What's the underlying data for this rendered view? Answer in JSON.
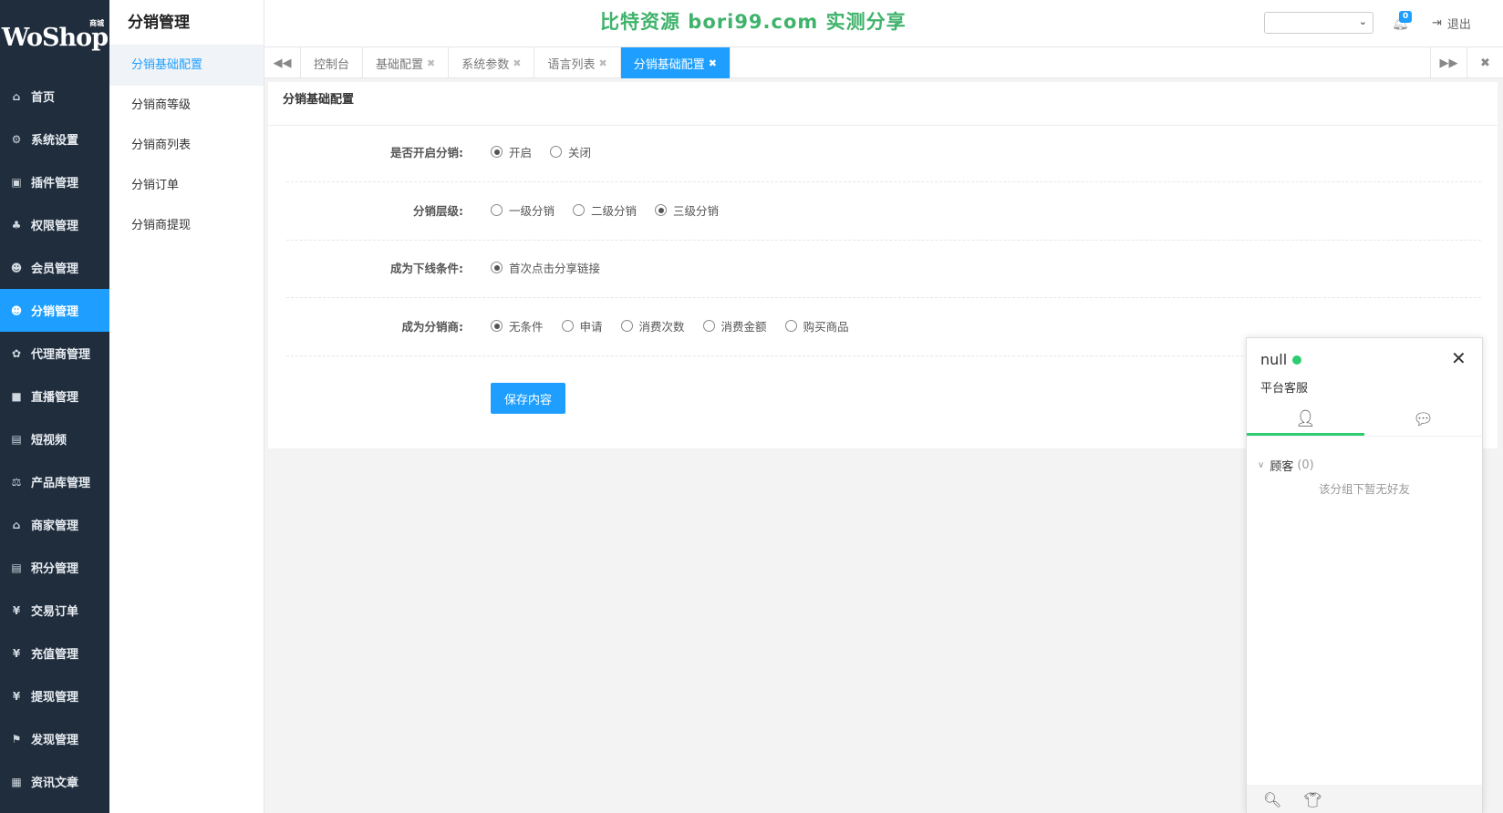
{
  "brand": {
    "name": "WoShop",
    "sup": "商城"
  },
  "nav": [
    {
      "icon": "home-icon",
      "glyph": "⌂",
      "label": "首页"
    },
    {
      "icon": "gear-icon",
      "glyph": "⚙",
      "label": "系统设置"
    },
    {
      "icon": "plugin-icon",
      "glyph": "▣",
      "label": "插件管理"
    },
    {
      "icon": "sitemap-icon",
      "glyph": "♣",
      "label": "权限管理"
    },
    {
      "icon": "users-icon",
      "glyph": "☻",
      "label": "会员管理"
    },
    {
      "icon": "users-icon",
      "glyph": "☻",
      "label": "分销管理",
      "active": true
    },
    {
      "icon": "agent-icon",
      "glyph": "✿",
      "label": "代理商管理"
    },
    {
      "icon": "video-camera-icon",
      "glyph": "■",
      "label": "直播管理"
    },
    {
      "icon": "document-icon",
      "glyph": "▤",
      "label": "短视频"
    },
    {
      "icon": "scale-icon",
      "glyph": "⚖",
      "label": "产品库管理"
    },
    {
      "icon": "bank-icon",
      "glyph": "⌂",
      "label": "商家管理"
    },
    {
      "icon": "points-icon",
      "glyph": "▤",
      "label": "积分管理"
    },
    {
      "icon": "yen-icon",
      "glyph": "¥",
      "label": "交易订单"
    },
    {
      "icon": "yen-icon",
      "glyph": "¥",
      "label": "充值管理"
    },
    {
      "icon": "yen-icon",
      "glyph": "¥",
      "label": "提现管理"
    },
    {
      "icon": "flag-icon",
      "glyph": "⚑",
      "label": "发现管理"
    },
    {
      "icon": "news-icon",
      "glyph": "▦",
      "label": "资讯文章"
    }
  ],
  "subnav": {
    "title": "分销管理",
    "items": [
      "分销基础配置",
      "分销商等级",
      "分销商列表",
      "分销订单",
      "分销商提现"
    ],
    "active_index": 0
  },
  "header": {
    "watermark": "比特资源 bori99.com 实测分享",
    "store_select_value": "",
    "notification_count": "0",
    "logout_label": "退出"
  },
  "tabs": [
    {
      "label": "控制台",
      "closable": false
    },
    {
      "label": "基础配置",
      "closable": true
    },
    {
      "label": "系统参数",
      "closable": true
    },
    {
      "label": "语言列表",
      "closable": true
    },
    {
      "label": "分销基础配置",
      "closable": true,
      "active": true
    }
  ],
  "form": {
    "title": "分销基础配置",
    "rows": [
      {
        "label": "是否开启分销:",
        "options": [
          "开启",
          "关闭"
        ],
        "selected": 0
      },
      {
        "label": "分销层级:",
        "options": [
          "一级分销",
          "二级分销",
          "三级分销"
        ],
        "selected": 2
      },
      {
        "label": "成为下线条件:",
        "options": [
          "首次点击分享链接"
        ],
        "selected": 0
      },
      {
        "label": "成为分销商:",
        "options": [
          "无条件",
          "申请",
          "消费次数",
          "消费金额",
          "购买商品"
        ],
        "selected": 0
      }
    ],
    "save_label": "保存内容"
  },
  "chat": {
    "name": "null",
    "subtitle": "平台客服",
    "group_label": "顾客",
    "group_count": "(0)",
    "empty_text": "该分组下暂无好友"
  },
  "colors": {
    "primary": "#1e9fff",
    "sidebar": "#1f2d3d",
    "online": "#2ecc71",
    "watermark": "#3fb36b"
  }
}
